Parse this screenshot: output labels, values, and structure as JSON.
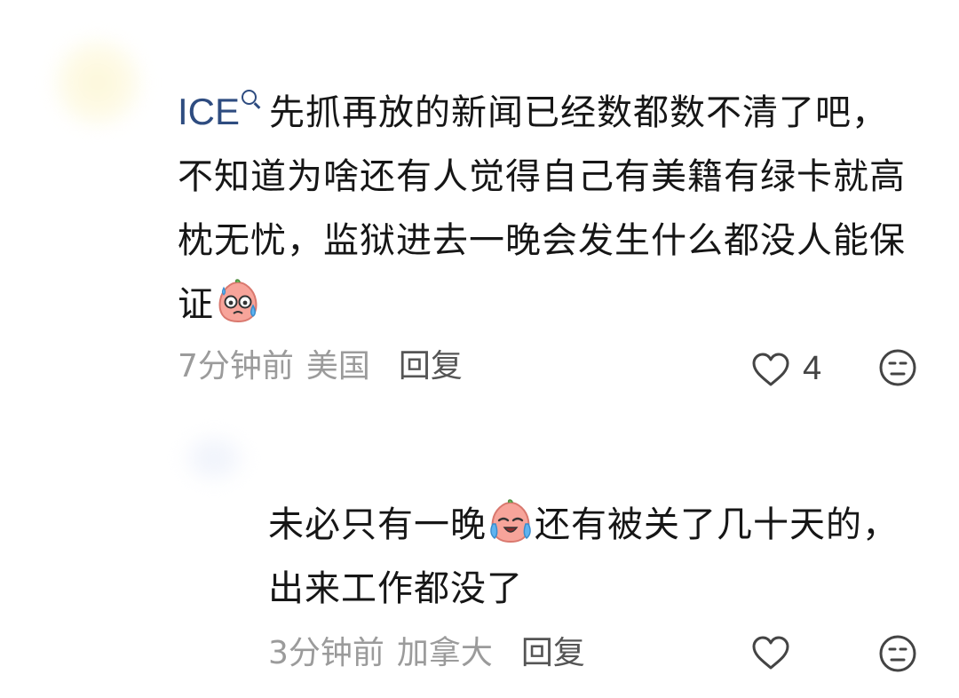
{
  "comment": {
    "username": "ICE",
    "text_part1": "先抓再放的新闻已经数都数不清了吧，不知道为啥还有人觉得自己有美籍有绿卡就高枕无忧，监狱进去一晚会发生什么都没人能保证",
    "emoji": "sweat-face-emoji",
    "time": "7分钟前",
    "location": "美国",
    "reply_label": "回复",
    "like_count": "4"
  },
  "reply": {
    "text_part1": "未必只有一晚",
    "emoji": "crying-face-emoji",
    "text_part2": "还有被关了几十天的，出来工作都没了",
    "time": "3分钟前",
    "location": "加拿大",
    "reply_label": "回复",
    "like_count": ""
  },
  "colors": {
    "username": "#2e4c80",
    "meta": "#9b9b9b",
    "emoji_face": "#f7a49a"
  }
}
